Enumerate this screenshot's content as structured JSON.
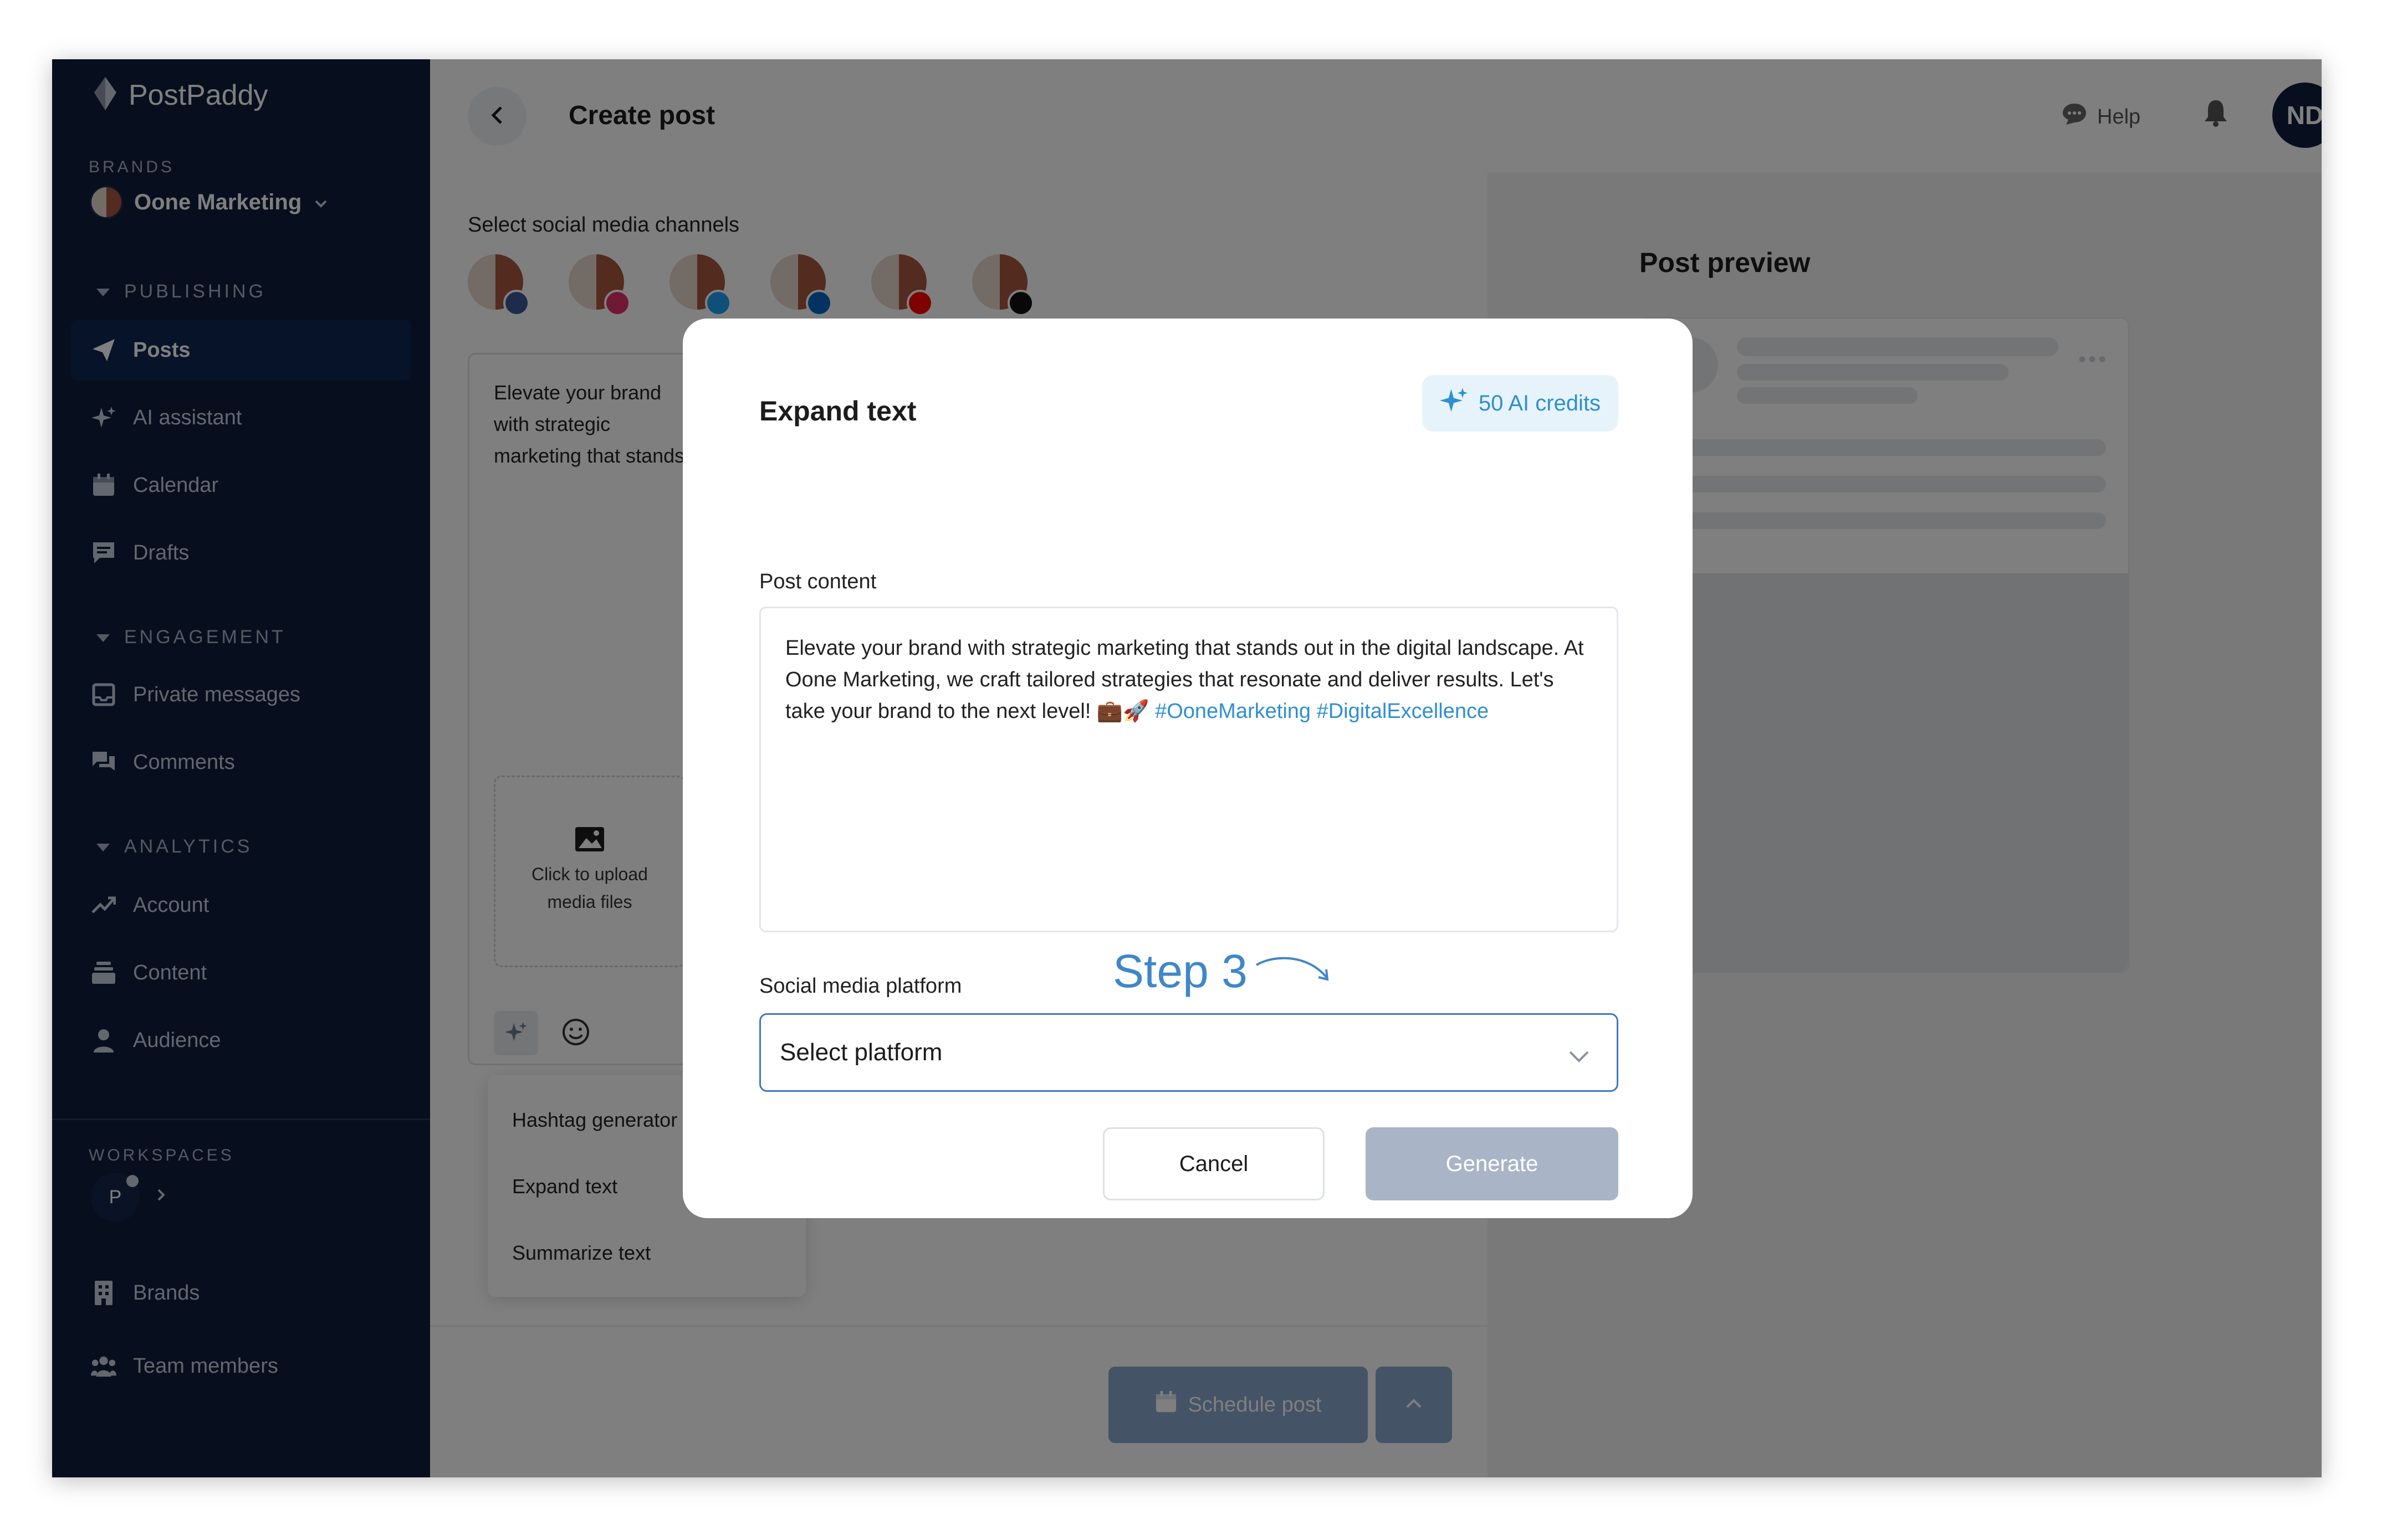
{
  "app": {
    "name": "PostPaddy"
  },
  "sidebar": {
    "brands_label": "BRANDS",
    "brand_name": "Oone Marketing",
    "sections": {
      "publishing": "PUBLISHING",
      "engagement": "ENGAGEMENT",
      "analytics": "ANALYTICS"
    },
    "items": {
      "posts": "Posts",
      "ai_assistant": "AI assistant",
      "calendar": "Calendar",
      "drafts": "Drafts",
      "private_messages": "Private messages",
      "comments": "Comments",
      "account": "Account",
      "content": "Content",
      "audience": "Audience",
      "brands": "Brands",
      "team_members": "Team members"
    },
    "workspaces_label": "WORKSPACES",
    "workspace_initial": "P"
  },
  "header": {
    "title": "Create post",
    "help_label": "Help",
    "user_initials": "ND"
  },
  "editor": {
    "channels_label": "Select social media channels",
    "channels": [
      {
        "icon": "facebook-icon",
        "color": "#3b5998"
      },
      {
        "icon": "instagram-icon",
        "color": "#e1306c"
      },
      {
        "icon": "twitter-icon",
        "color": "#1da1f2"
      },
      {
        "icon": "linkedin-icon",
        "color": "#0a66c2"
      },
      {
        "icon": "youtube-icon",
        "color": "#ff0000"
      },
      {
        "icon": "tiktok-icon",
        "color": "#111111"
      }
    ],
    "text_preview": "Elevate your brand with strategic marketing that stands out in the digital landscape. At Oone Marketing, we craft tailored strategies that resonate and deliver results. Let's take your brand to the next level! 💼🚀",
    "upload_label": "Click to upload media files",
    "ai_menu": [
      "Hashtag generator",
      "Expand text",
      "Summarize text"
    ],
    "schedule_label": "Schedule post"
  },
  "preview": {
    "title": "Post preview"
  },
  "modal": {
    "title": "Expand text",
    "credits_label": "50 AI credits",
    "content_label": "Post content",
    "content_text": "Elevate your brand with strategic marketing that stands out in the digital landscape. At Oone Marketing, we craft tailored strategies that resonate and deliver results. Let's take your brand to the next level! 💼🚀",
    "hashtags": "#OoneMarketing #DigitalExcellence",
    "platform_label": "Social media platform",
    "platform_placeholder": "Select platform",
    "step_label": "Step 3",
    "cancel_label": "Cancel",
    "generate_label": "Generate"
  },
  "colors": {
    "sidebar_bg": "#0f1f3c",
    "accent": "#3f78c6",
    "credits_text": "#2f8fd0",
    "hashtag": "#2f8fd0"
  }
}
